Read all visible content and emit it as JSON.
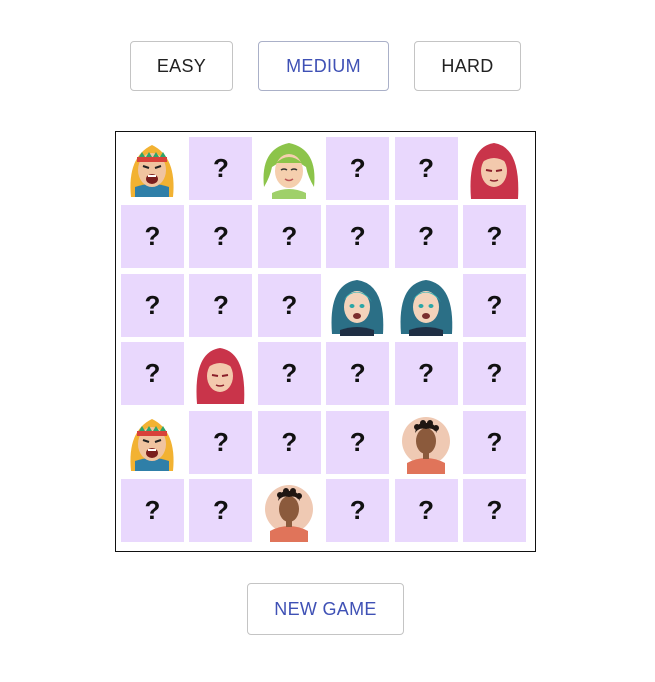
{
  "difficulty": {
    "options": [
      "EASY",
      "MEDIUM",
      "HARD"
    ],
    "selected": "MEDIUM"
  },
  "board": {
    "rows": 6,
    "cols": 6,
    "hidden_symbol": "?",
    "cells": [
      [
        "avatar-headband-shouting",
        "?",
        "avatar-green-hair-woman",
        "?",
        "?",
        "avatar-red-hijab-woman"
      ],
      [
        "?",
        "?",
        "?",
        "?",
        "?",
        "?"
      ],
      [
        "?",
        "?",
        "?",
        "avatar-teal-hair-woman",
        "avatar-teal-hair-woman",
        "?"
      ],
      [
        "?",
        "avatar-red-hijab-woman",
        "?",
        "?",
        "?",
        "?"
      ],
      [
        "avatar-headband-shouting",
        "?",
        "?",
        "?",
        "avatar-curly-hair-man",
        "?"
      ],
      [
        "?",
        "?",
        "avatar-curly-hair-man",
        "?",
        "?",
        "?"
      ]
    ]
  },
  "actions": {
    "new_game_label": "NEW GAME"
  },
  "colors": {
    "hidden_cell": "#e9d8fd",
    "accent": "#3f51b5",
    "border": "#c4c4c4"
  }
}
